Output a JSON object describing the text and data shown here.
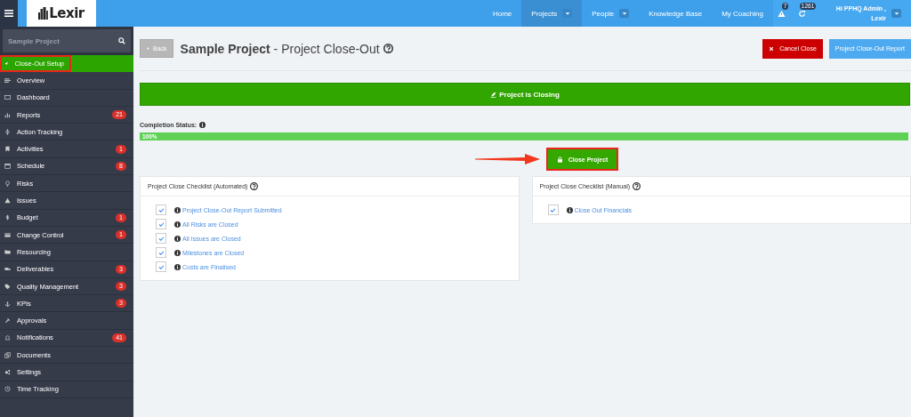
{
  "topbar": {
    "nav": [
      {
        "label": "Home",
        "selected": false,
        "dropdown": false
      },
      {
        "label": "Projects",
        "selected": true,
        "dropdown": true
      },
      {
        "label": "People",
        "selected": false,
        "dropdown": true
      },
      {
        "label": "Knowledge Base",
        "selected": false,
        "dropdown": false
      },
      {
        "label": "My Coaching",
        "selected": false,
        "dropdown": false
      }
    ],
    "alerts": [
      {
        "count": "7"
      },
      {
        "count": "1261"
      }
    ],
    "user": {
      "greeting": "Hi PPHQ Admin ,",
      "company": "Lexir"
    }
  },
  "logo": "Lexir",
  "sidebar": {
    "search": {
      "value": "Sample Project"
    },
    "items": [
      {
        "label": "Close-Out Setup",
        "selected": true,
        "highlighted": true
      },
      {
        "label": "Overview",
        "selected": false,
        "highlighted": false
      },
      {
        "label": "Dashboard",
        "selected": false,
        "highlighted": false
      },
      {
        "label": "Reports",
        "badge": "21",
        "selected": false,
        "highlighted": false
      },
      {
        "label": "Action Tracking",
        "selected": false,
        "highlighted": false
      },
      {
        "label": "Activities",
        "badge": "1",
        "selected": false,
        "highlighted": false
      },
      {
        "label": "Schedule",
        "badge": "8",
        "selected": false,
        "highlighted": false
      },
      {
        "label": "Risks",
        "selected": false,
        "highlighted": false
      },
      {
        "label": "Issues",
        "selected": false,
        "highlighted": false
      },
      {
        "label": "Budget",
        "badge": "1",
        "selected": false,
        "highlighted": false
      },
      {
        "label": "Change Control",
        "badge": "1",
        "selected": false,
        "highlighted": false
      },
      {
        "label": "Resourcing",
        "selected": false,
        "highlighted": false
      },
      {
        "label": "Deliverables",
        "badge": "3",
        "selected": false,
        "highlighted": false
      },
      {
        "label": "Quality Management",
        "badge": "3",
        "selected": false,
        "highlighted": false
      },
      {
        "label": "KPIs",
        "badge": "3",
        "selected": false,
        "highlighted": false
      },
      {
        "label": "Approvals",
        "selected": false,
        "highlighted": false
      },
      {
        "label": "Notifications",
        "badge": "41",
        "selected": false,
        "highlighted": false
      },
      {
        "label": "Documents",
        "selected": false,
        "highlighted": false
      },
      {
        "label": "Settings",
        "selected": false,
        "highlighted": false
      },
      {
        "label": "Time Tracking",
        "selected": false,
        "highlighted": false
      }
    ]
  },
  "header": {
    "back": "Back",
    "title_bold": "Sample Project",
    "title_rest": " - Project Close-Out",
    "buttons": [
      {
        "label": "Cancel Close",
        "kind": "danger"
      },
      {
        "label": "Project Close-Out Report",
        "kind": "info"
      }
    ]
  },
  "banner": "Project is Closing",
  "completion": {
    "label": "Completion Status:",
    "level": 1,
    "reading": "100%"
  },
  "close_button": {
    "label": "Close Project",
    "highlighted": true,
    "arrow": true
  },
  "checklists": [
    {
      "title": "Project Close Checklist (Automated)",
      "items": [
        {
          "label": "Project Close-Out Report Submitted",
          "checked": true
        },
        {
          "label": "All Risks are Closed",
          "checked": true
        },
        {
          "label": "All Issues are Closed",
          "checked": true
        },
        {
          "label": "Milestones are Closed",
          "checked": true
        },
        {
          "label": "Costs are Finalised",
          "checked": true
        }
      ]
    },
    {
      "title": "Project Close Checklist (Manual)",
      "items": [
        {
          "label": "Close Out Financials",
          "checked": true
        }
      ]
    }
  ]
}
